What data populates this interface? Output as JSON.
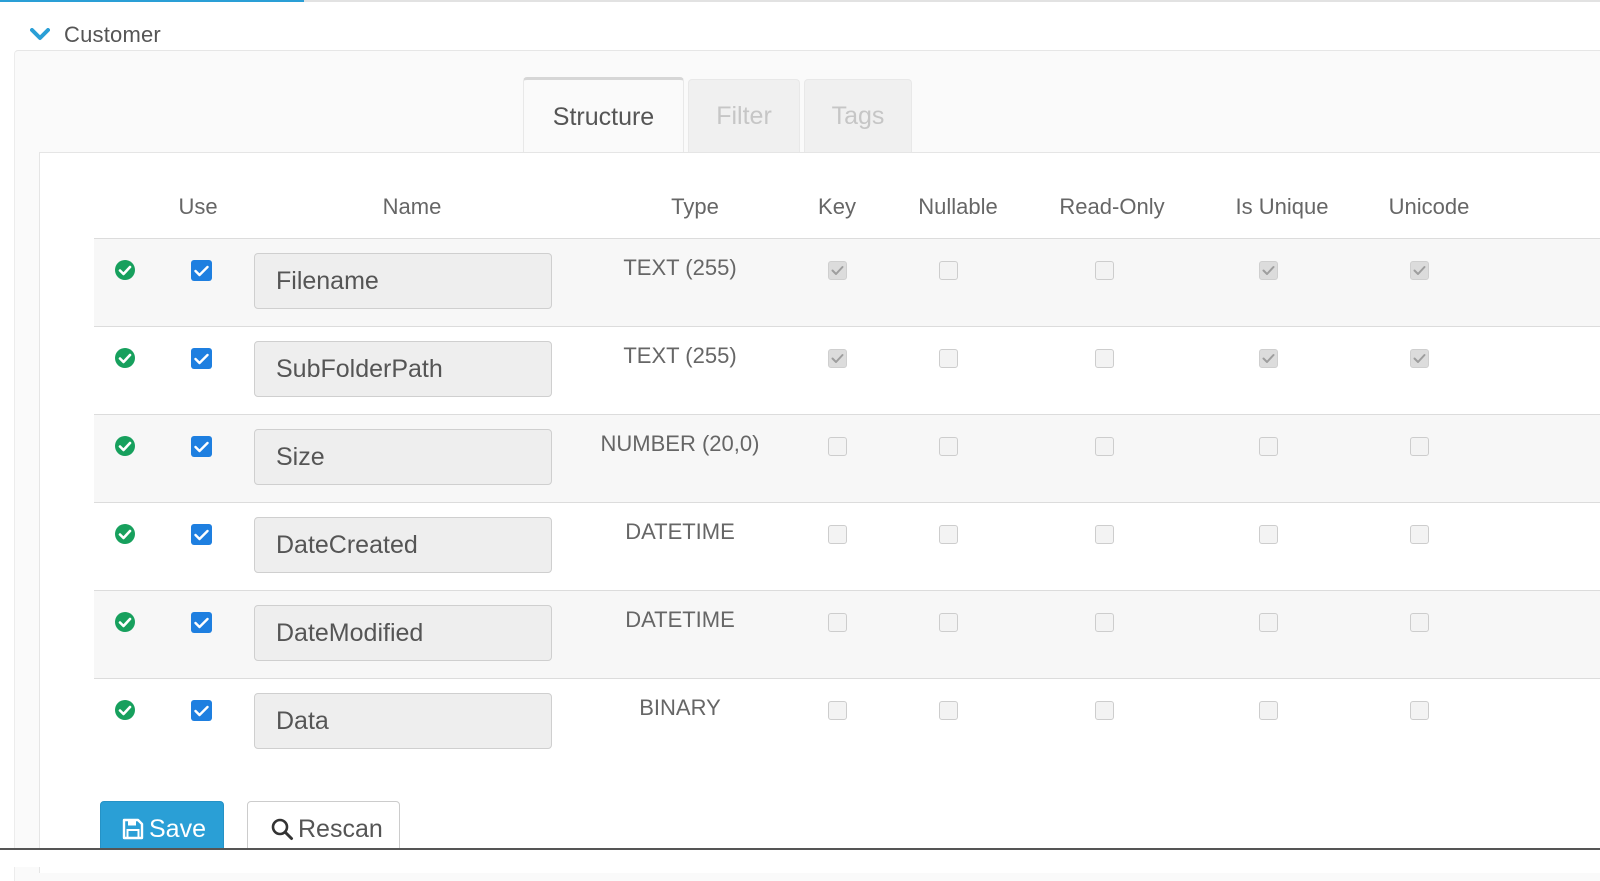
{
  "section": {
    "title": "Customer",
    "icon": "chevron-down-icon"
  },
  "progress": {
    "fraction": 0.19
  },
  "tabs": [
    {
      "label": "Structure",
      "active": true
    },
    {
      "label": "Filter",
      "active": false
    },
    {
      "label": "Tags",
      "active": false
    }
  ],
  "columns": {
    "use": "Use",
    "name": "Name",
    "type": "Type",
    "key": "Key",
    "nullable": "Nullable",
    "readonly": "Read-Only",
    "unique": "Is Unique",
    "unicode": "Unicode"
  },
  "fields": [
    {
      "name": "Filename",
      "type": "TEXT (255)",
      "status": "valid",
      "use": true,
      "key": true,
      "nullable": false,
      "readonly": false,
      "unique": true,
      "unicode": true
    },
    {
      "name": "SubFolderPath",
      "type": "TEXT (255)",
      "status": "valid",
      "use": true,
      "key": true,
      "nullable": false,
      "readonly": false,
      "unique": true,
      "unicode": true
    },
    {
      "name": "Size",
      "type": "NUMBER (20,0)",
      "status": "valid",
      "use": true,
      "key": false,
      "nullable": false,
      "readonly": false,
      "unique": false,
      "unicode": false
    },
    {
      "name": "DateCreated",
      "type": "DATETIME",
      "status": "valid",
      "use": true,
      "key": false,
      "nullable": false,
      "readonly": false,
      "unique": false,
      "unicode": false
    },
    {
      "name": "DateModified",
      "type": "DATETIME",
      "status": "valid",
      "use": true,
      "key": false,
      "nullable": false,
      "readonly": false,
      "unique": false,
      "unicode": false
    },
    {
      "name": "Data",
      "type": "BINARY",
      "status": "valid",
      "use": true,
      "key": false,
      "nullable": false,
      "readonly": false,
      "unique": false,
      "unicode": false
    }
  ],
  "buttons": {
    "save": {
      "label": "Save",
      "icon": "floppy-disk-icon"
    },
    "rescan": {
      "label": "Rescan",
      "icon": "search-icon"
    }
  },
  "colors": {
    "accent": "#2a9fd6",
    "checkbox_checked": "#1e7fe0",
    "status_ok": "#17a05d"
  }
}
